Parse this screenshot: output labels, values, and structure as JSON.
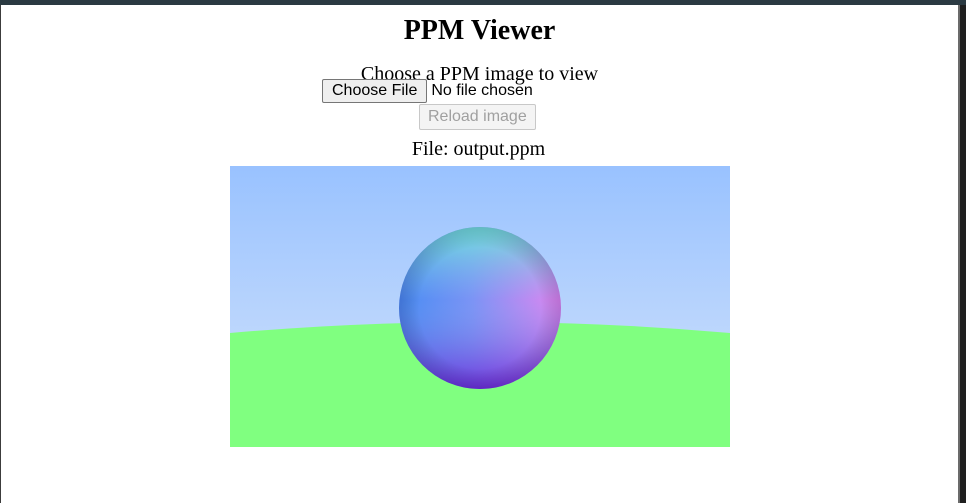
{
  "page": {
    "title": "PPM Viewer",
    "subtitle": "Choose a PPM image to view"
  },
  "file_input": {
    "button_label": "Choose File",
    "status_text": "No file chosen"
  },
  "reload": {
    "label": "Reload image",
    "disabled": true
  },
  "file_info": {
    "text": "File: output.ppm"
  },
  "image": {
    "description_colors": {
      "sky_top": "#99c2ff",
      "sky_bottom": "#d4e4fb",
      "ground": "#80ff80"
    }
  },
  "colors": {
    "top_bar": "#2b3a42",
    "disabled_text": "#a0a0a0"
  }
}
